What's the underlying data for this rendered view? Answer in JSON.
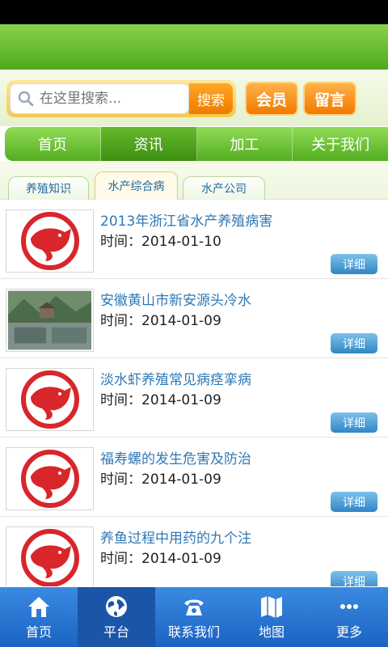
{
  "search": {
    "placeholder": "在这里搜索...",
    "button_label": "搜索"
  },
  "header_buttons": {
    "member": "会员",
    "message": "留言"
  },
  "main_tabs": [
    {
      "label": "首页"
    },
    {
      "label": "资讯"
    },
    {
      "label": "加工"
    },
    {
      "label": "关于我们"
    }
  ],
  "sub_tabs": [
    {
      "label": "养殖知识"
    },
    {
      "label": "水产综合病"
    },
    {
      "label": "水产公司"
    }
  ],
  "list": [
    {
      "title": "2013年浙江省水产养殖病害",
      "time": "时间：2014-01-10",
      "detail": "详细",
      "thumb": "fish-logo"
    },
    {
      "title": "安徽黄山市新安源头冷水",
      "time": "时间：2014-01-09",
      "detail": "详细",
      "thumb": "photo"
    },
    {
      "title": "淡水虾养殖常见病痉挛病",
      "time": "时间：2014-01-09",
      "detail": "详细",
      "thumb": "fish-logo"
    },
    {
      "title": "福寿螺的发生危害及防治",
      "time": "时间：2014-01-09",
      "detail": "详细",
      "thumb": "fish-logo"
    },
    {
      "title": "养鱼过程中用药的九个注",
      "time": "时间：2014-01-09",
      "detail": "详细",
      "thumb": "fish-logo"
    }
  ],
  "bottom_nav": [
    {
      "label": "首页",
      "icon": "home-icon"
    },
    {
      "label": "平台",
      "icon": "globe-icon"
    },
    {
      "label": "联系我们",
      "icon": "phone-icon"
    },
    {
      "label": "地图",
      "icon": "map-icon"
    },
    {
      "label": "更多",
      "icon": "more-icon"
    }
  ],
  "colors": {
    "green": "#52ad1f",
    "orange": "#f07a00",
    "blue": "#1b63c2",
    "link": "#2f78b4"
  }
}
